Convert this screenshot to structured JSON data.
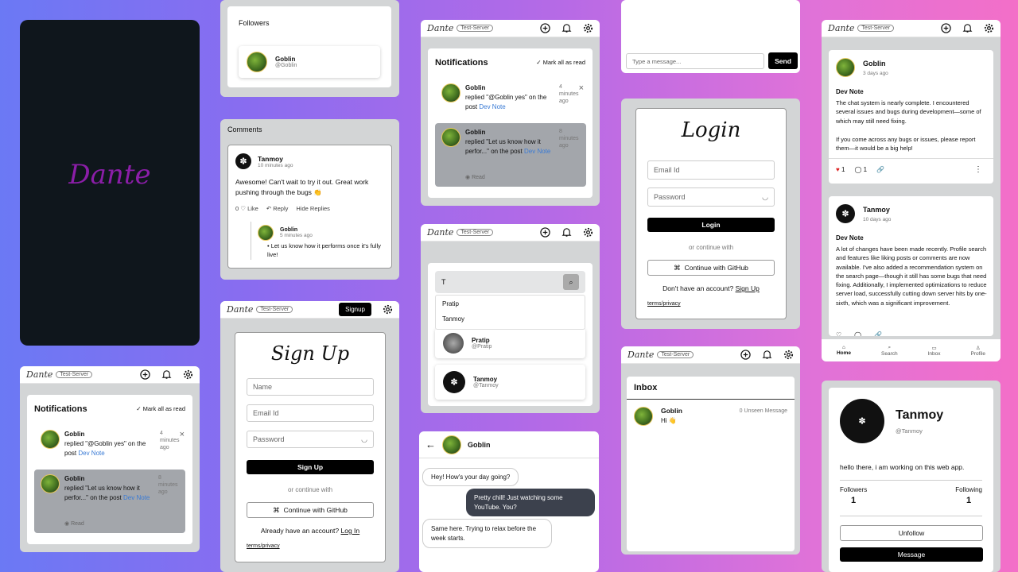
{
  "splash": {
    "logo": "Dante"
  },
  "followers": {
    "title": "Followers",
    "user": {
      "name": "Goblin",
      "handle": "@Goblin"
    }
  },
  "comments": {
    "title": "Comments",
    "author": "Tanmoy",
    "time": "10 minutes ago",
    "body": "Awesome! Can't wait to try it out. Great work pushing through the bugs 👏",
    "likes": "0",
    "like_label": "Like",
    "reply_label": "Reply",
    "hide_label": "Hide Replies",
    "reply": {
      "author": "Goblin",
      "time": "5 minutes ago",
      "body": "• Let us know how it performs once it's fully live!"
    }
  },
  "app": {
    "logo": "Dante",
    "server": "Test-Server",
    "signup_btn": "Signup"
  },
  "notifications": {
    "title": "Notifications",
    "mark_all": "Mark all as read",
    "items": [
      {
        "user": "Goblin",
        "text": "replied \"@Goblin yes\" on the post",
        "link": "Dev Note",
        "time": "4 minutes ago"
      },
      {
        "user": "Goblin",
        "text": "replied \"Let us know how it perfor...\" on the post",
        "link": "Dev Note",
        "time": "8 minutes ago",
        "read": "Read"
      }
    ]
  },
  "signup": {
    "heading": "Sign Up",
    "name_ph": "Name",
    "email_ph": "Email Id",
    "password_ph": "Password",
    "submit": "Sign Up",
    "or": "or continue with",
    "github": "Continue with GitHub",
    "already": "Already have an account?",
    "login_link": "Log In",
    "terms": "terms/privacy"
  },
  "search": {
    "query": "T",
    "suggestions": [
      "Pratip",
      "Tanmoy"
    ],
    "results": [
      {
        "name": "Pratip",
        "handle": "@Pratip"
      },
      {
        "name": "Tanmoy",
        "handle": "@Tanmoy"
      }
    ]
  },
  "chat": {
    "user": "Goblin",
    "messages": [
      {
        "side": "in",
        "text": "Hey! How's your day going?"
      },
      {
        "side": "out",
        "text": "Pretty chill! Just watching some YouTube. You?"
      },
      {
        "side": "in",
        "text": "Same here. Trying to relax before the week starts."
      }
    ],
    "input_ph": "Type a message...",
    "send": "Send"
  },
  "login": {
    "heading": "Login",
    "email_ph": "Email Id",
    "password_ph": "Password",
    "submit": "Login",
    "or": "or continue with",
    "github": "Continue with GitHub",
    "no_account": "Don't have an account?",
    "signup_link": "Sign Up",
    "terms": "terms/privacy"
  },
  "inbox": {
    "title": "Inbox",
    "user": "Goblin",
    "preview": "Hi 👋",
    "unseen": "0 Unseen Message"
  },
  "feed": {
    "posts": [
      {
        "author": "Goblin",
        "time": "3 days ago",
        "title": "Dev Note",
        "body": "The chat system is nearly complete. I encountered several issues and bugs during development—some of which may still need fixing.",
        "body2": "If you come across any bugs or issues, please report them—it would be a big help!",
        "likes": "1",
        "comments": "1"
      },
      {
        "author": "Tanmoy",
        "time": "10 days ago",
        "title": "Dev Note",
        "body": "A lot of changes have been made recently. Profile search and features like liking posts or comments are now available. I've also added a recommendation system on the search page—though it still has some bugs that need fixing. Additionally, I implemented optimizations to reduce server load, successfully cutting down server hits by one-sixth, which was a significant improvement."
      }
    ],
    "nav": [
      "Home",
      "Search",
      "Inbox",
      "Profile"
    ]
  },
  "profile": {
    "name": "Tanmoy",
    "handle": "@Tanmoy",
    "bio": "hello there, i am working on this web app.",
    "followers_label": "Followers",
    "followers": "1",
    "following_label": "Following",
    "following": "1",
    "unfollow": "Unfollow",
    "message": "Message"
  }
}
